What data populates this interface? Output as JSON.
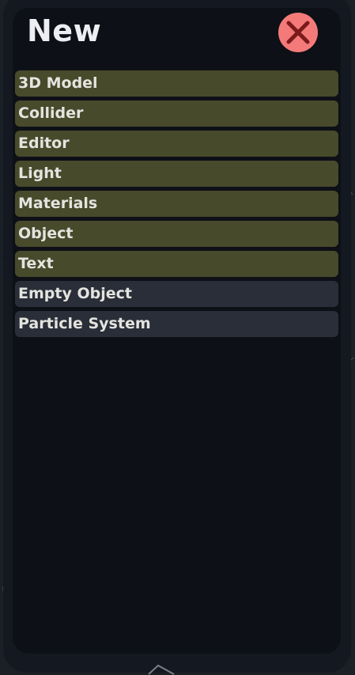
{
  "dialog": {
    "title": "New",
    "close_icon": "close-icon",
    "close_color": "#f47a7a",
    "close_glyph_color": "#7a1a1a"
  },
  "menu": {
    "categories": [
      {
        "label": "3D Model"
      },
      {
        "label": "Collider"
      },
      {
        "label": "Editor"
      },
      {
        "label": "Light"
      },
      {
        "label": "Materials"
      },
      {
        "label": "Object"
      },
      {
        "label": "Text"
      }
    ],
    "actions": [
      {
        "label": "Empty Object"
      },
      {
        "label": "Particle System"
      }
    ]
  },
  "colors": {
    "category_bg": "#484a2c",
    "action_bg": "#2a2e38",
    "panel_bg": "#0d1016",
    "text": "#e4e4df"
  }
}
